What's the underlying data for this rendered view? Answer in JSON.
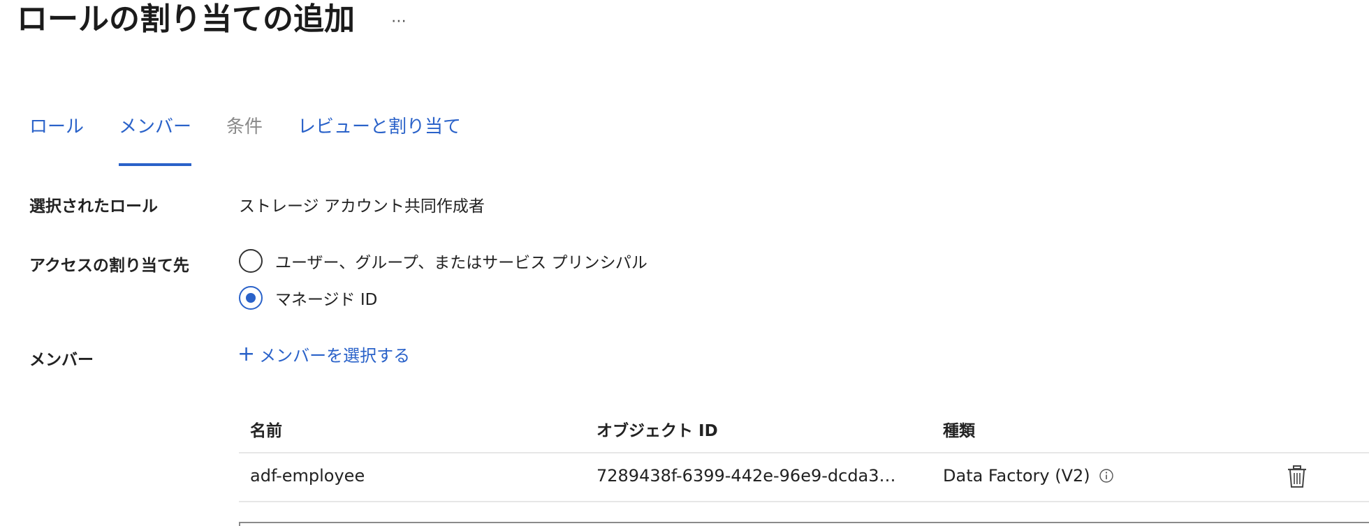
{
  "header": {
    "title": "ロールの割り当ての追加",
    "more_label": "⋯"
  },
  "tabs": [
    {
      "label": "ロール",
      "state": "enabled"
    },
    {
      "label": "メンバー",
      "state": "active"
    },
    {
      "label": "条件",
      "state": "disabled"
    },
    {
      "label": "レビューと割り当て",
      "state": "enabled"
    }
  ],
  "form": {
    "selected_role_label": "選択されたロール",
    "selected_role_value": "ストレージ アカウント共同作成者",
    "assign_access_label": "アクセスの割り当て先",
    "assign_options": [
      {
        "label": "ユーザー、グループ、またはサービス プリンシパル",
        "selected": false
      },
      {
        "label": "マネージド ID",
        "selected": true
      }
    ],
    "members_label": "メンバー",
    "add_members_label": "メンバーを選択する"
  },
  "members_table": {
    "columns": [
      "名前",
      "オブジェクト ID",
      "種類"
    ],
    "rows": [
      {
        "name": "adf-employee",
        "object_id": "7289438f-6399-442e-96e9-dcda3…",
        "type": "Data Factory (V2)"
      }
    ]
  },
  "colors": {
    "accent": "#2a62c9",
    "disabled": "#8a8a8a"
  },
  "icons": {
    "more": "ellipsis-icon",
    "add": "plus-icon",
    "info": "info-icon",
    "delete": "trash-icon"
  }
}
